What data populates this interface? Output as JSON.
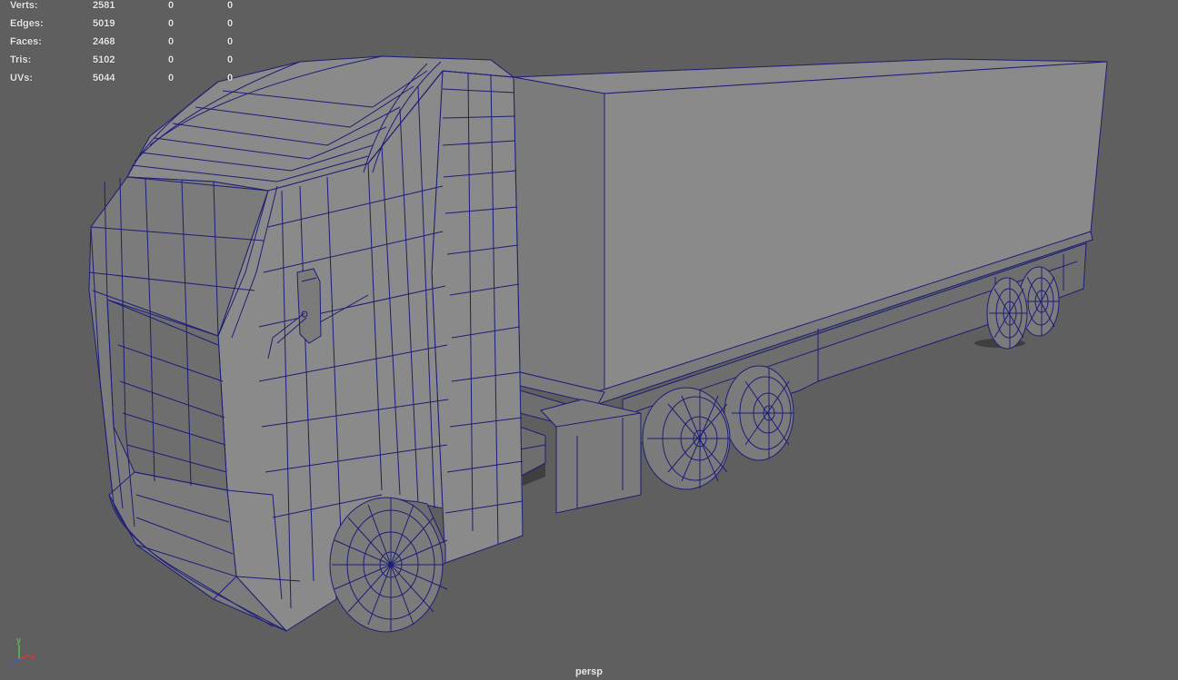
{
  "hud": {
    "rows": [
      {
        "label": "Verts:",
        "value": "2581",
        "sel1": "0",
        "sel2": "0"
      },
      {
        "label": "Edges:",
        "value": "5019",
        "sel1": "0",
        "sel2": "0"
      },
      {
        "label": "Faces:",
        "value": "2468",
        "sel1": "0",
        "sel2": "0"
      },
      {
        "label": "Tris:",
        "value": "5102",
        "sel1": "0",
        "sel2": "0"
      },
      {
        "label": "UVs:",
        "value": "5044",
        "sel1": "0",
        "sel2": "0"
      }
    ]
  },
  "camera": {
    "name": "persp"
  },
  "gizmo": {
    "x": "x",
    "y": "y",
    "z": "z"
  },
  "colors": {
    "background": "#5f5f5f",
    "mesh_fill": "#8a8a8a",
    "mesh_shadow": "#6f6f6f",
    "wire": "#1c1d78",
    "axis_x": "#d63a3a",
    "axis_y": "#4fc24f",
    "axis_z": "#3a5bd6"
  }
}
